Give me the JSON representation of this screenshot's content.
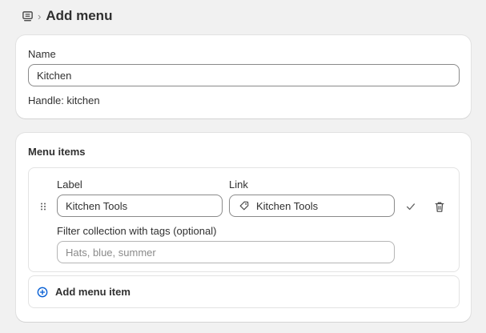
{
  "header": {
    "icon": "menu-navigation-icon",
    "breadcrumb_separator": "›",
    "title": "Add menu"
  },
  "name_card": {
    "name_label": "Name",
    "name_value": "Kitchen",
    "handle_text": "Handle: kitchen"
  },
  "menu_items": {
    "title": "Menu items",
    "items": [
      {
        "drag_icon": "drag-handle-icon",
        "label_heading": "Label",
        "label_value": "Kitchen Tools",
        "link_heading": "Link",
        "link_icon": "tag-icon",
        "link_value": "Kitchen Tools",
        "confirm_icon": "checkmark-icon",
        "delete_icon": "trash-icon",
        "filter_label": "Filter collection with tags (optional)",
        "filter_placeholder": "Hats, blue, summer"
      }
    ],
    "add_label": "Add menu item",
    "add_icon": "plus-circle-icon"
  },
  "colors": {
    "background": "#f1f1f1",
    "card": "#ffffff",
    "text": "#303030",
    "accent_blue": "#005bd3",
    "muted": "#8a8a8a"
  }
}
